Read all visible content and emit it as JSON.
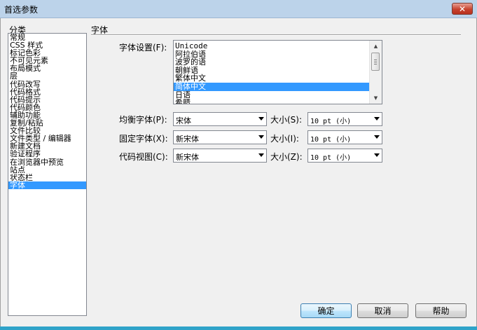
{
  "window": {
    "title": "首选参数",
    "close_glyph": "✕"
  },
  "categories": {
    "title": "分类",
    "items": [
      "常规",
      "CSS 样式",
      "标记色彩",
      "不可见元素",
      "布局模式",
      "层",
      "代码改写",
      "代码格式",
      "代码提示",
      "代码颜色",
      "辅助功能",
      "复制/粘贴",
      "文件比较",
      "文件类型 / 编辑器",
      "新建文档",
      "验证程序",
      "在浏览器中预览",
      "站点",
      "状态栏",
      "字体"
    ],
    "selected": "字体"
  },
  "section": {
    "title": "字体"
  },
  "encoding": {
    "label": "字体设置(F):",
    "items": [
      "Unicode",
      "阿拉伯语",
      "波罗的语",
      "朝鲜语",
      "繁体中文",
      "简体中文",
      "日语",
      "希腊"
    ],
    "selected": "简体中文"
  },
  "fonts": {
    "proportional": {
      "label": "均衡字体(P):",
      "value": "宋体",
      "size_label": "大小(S):",
      "size": "10 pt (小)"
    },
    "fixed": {
      "label": "固定字体(X):",
      "value": "新宋体",
      "size_label": "大小(I):",
      "size": "10 pt (小)"
    },
    "code_view": {
      "label": "代码视图(C):",
      "value": "新宋体",
      "size_label": "大小(Z):",
      "size": "10 pt (小)"
    }
  },
  "buttons": {
    "ok": "确定",
    "cancel": "取消",
    "help": "帮助"
  },
  "colors": {
    "selection": "#3399ff",
    "titlebar": "#bcd3ea",
    "close": "#c7432f"
  }
}
